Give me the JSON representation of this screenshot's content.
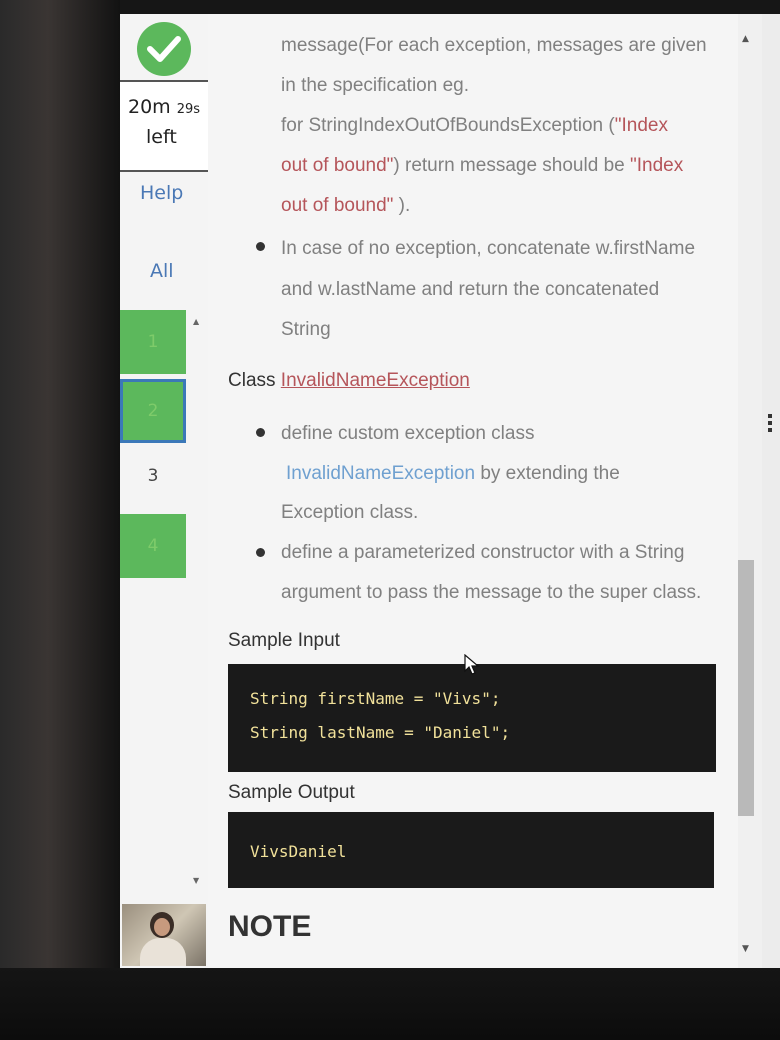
{
  "sidebar": {
    "timer_time": "20m",
    "timer_seconds": "29s",
    "timer_left": "left",
    "help": "Help",
    "all": "All",
    "questions": [
      "1",
      "2",
      "3",
      "4"
    ]
  },
  "content": {
    "p1_line1": "message(For each exception, messages are given",
    "p1_line2": "in the specification eg.",
    "p1_line3_a": "for StringIndexOutOfBoundsException (",
    "p1_line3_b": "\"Index",
    "p1_line4_a": "out of bound\"",
    "p1_line4_b": ") return message should be ",
    "p1_line4_c": "\"Index",
    "p1_line5_a": "out of bound\"",
    "p1_line5_b": " ).",
    "b1_line1": "In case of no exception, concatenate w.firstName",
    "b1_line2": "and w.lastName and return the concatenated",
    "b1_line3": "String",
    "class_prefix": "Class ",
    "class_name": "InvalidNameException",
    "b2_line1": "define custom exception class",
    "b2_line2_a": "InvalidNameException",
    "b2_line2_b": " by extending the",
    "b2_line3": "Exception class.",
    "b3_line1": "define a parameterized constructor with a String",
    "b3_line2": "argument to pass the message to the super class.",
    "sample_input_title": "Sample Input",
    "code_line1": "String firstName = \"Vivs\";",
    "code_line2": "String lastName = \"Daniel\";",
    "sample_output_title": "Sample Output",
    "output_line": "VivsDaniel",
    "note": "NOTE"
  },
  "colors": {
    "success_green": "#5cb85c",
    "link_blue": "#4a78b5",
    "class_link_red": "#b5555a",
    "code_bg": "#1a1a1a",
    "code_text": "#f1e19a"
  },
  "icons": {
    "status": "checkmark-icon",
    "cursor": "mouse-pointer-icon"
  }
}
